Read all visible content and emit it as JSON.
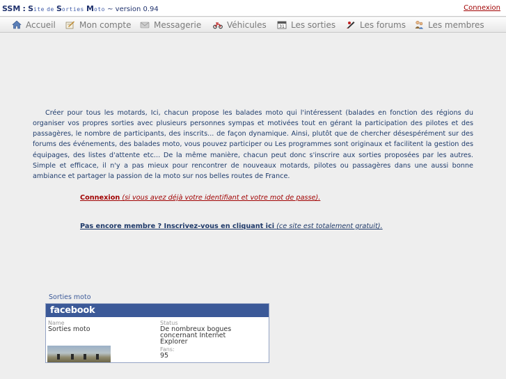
{
  "header": {
    "brand_short": "SSM",
    "brand_sep": ":",
    "brand_words": [
      {
        "initial": "S",
        "rest": "ite"
      },
      {
        "initial": "",
        "rest": "de"
      },
      {
        "initial": "S",
        "rest": "orties"
      },
      {
        "initial": "M",
        "rest": "oto"
      }
    ],
    "version": "~ version 0.94",
    "login_link": "Connexion"
  },
  "nav": {
    "items": [
      {
        "label": "Accueil",
        "icon": "home-icon"
      },
      {
        "label": "Mon compte",
        "icon": "account-icon"
      },
      {
        "label": "Messagerie",
        "icon": "mail-icon"
      },
      {
        "label": "Véhicules",
        "icon": "motorcycle-icon"
      },
      {
        "label": "Les sorties",
        "icon": "calendar-icon"
      },
      {
        "label": "Les forums",
        "icon": "forum-icon"
      },
      {
        "label": "Les membres",
        "icon": "members-icon"
      }
    ]
  },
  "main": {
    "intro": "Créer pour tous les motards, Ici, chacun propose les balades moto qui l'intéressent (balades en fonction des régions du organiser vos propres sorties avec plusieurs personnes sympas et motivées tout en gérant la participation des pilotes et des passagères, le nombre de participants, des inscrits... de façon dynamique. Ainsi, plutôt que de chercher désespérément sur des forums des événements, des balades moto, vous pouvez participer ou Les programmes sont originaux et facilitent la gestion des équipages, des listes d'attente etc... De la même manière, chacun peut donc s'inscrire aux sorties proposées par les autres. Simple et efficace, il n'y a pas mieux pour rencontrer de nouveaux motards, pilotes ou passagères dans une aussi bonne ambiance et partager la passion de la moto sur nos belles routes de France.",
    "login_label": "Connexion",
    "login_note": "(si vous avez déjà votre identifiant et votre mot de passe).",
    "register_label": "Pas encore membre ? Inscrivez-vous en cliquant ici",
    "register_note": "(ce site est totalement gratuit)."
  },
  "facebook": {
    "title": "Sorties moto",
    "logo": "facebook",
    "name_label": "Name",
    "name_value": "Sorties moto",
    "status_label": "Status",
    "status_value_lines": [
      "De nombreux bogues",
      "concernant Internet",
      "Explorer"
    ],
    "fans_label": "Fans:",
    "fans_value": "95"
  },
  "colors": {
    "accent_link": "#a00000",
    "text_blue": "#1f3c6c",
    "facebook_blue": "#3b5998"
  }
}
